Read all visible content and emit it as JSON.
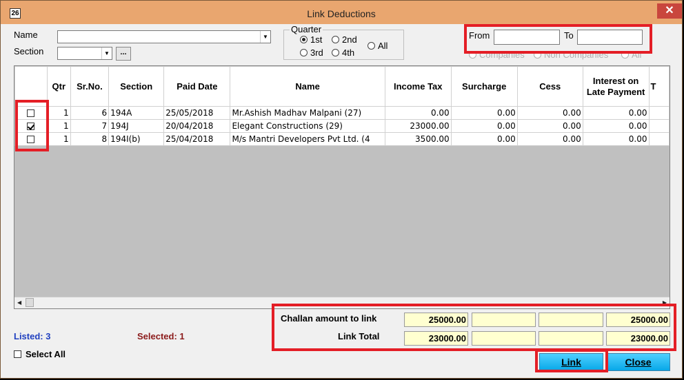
{
  "window": {
    "title": "Link Deductions",
    "icon_text": "26",
    "close_glyph": "✕"
  },
  "filters": {
    "name_label": "Name",
    "name_value": "",
    "section_label": "Section",
    "section_value": "",
    "browse_label": "...",
    "quarter": {
      "legend": "Quarter",
      "options": [
        "1st",
        "2nd",
        "3rd",
        "4th",
        "All"
      ],
      "selected": "1st"
    },
    "from_label": "From",
    "from_value": "",
    "to_label": "To",
    "to_value": "",
    "company_filter": {
      "options": [
        "Companies",
        "Non Companies",
        "All"
      ],
      "selected": "Companies"
    }
  },
  "grid": {
    "columns": [
      "",
      "Qtr",
      "Sr.No.",
      "Section",
      "Paid Date",
      "Name",
      "Income Tax",
      "Surcharge",
      "Cess",
      "Interest on Late Payment",
      "T"
    ],
    "rows": [
      {
        "checked": false,
        "qtr": "1",
        "sr": "6",
        "section": "194A",
        "paid_date": "25/05/2018",
        "name": "Mr.Ashish Madhav Malpani (27)",
        "income_tax": "0.00",
        "surcharge": "0.00",
        "cess": "0.00",
        "interest": "0.00"
      },
      {
        "checked": true,
        "qtr": "1",
        "sr": "7",
        "section": "194J",
        "paid_date": "20/04/2018",
        "name": "Elegant Constructions (29)",
        "income_tax": "23000.00",
        "surcharge": "0.00",
        "cess": "0.00",
        "interest": "0.00"
      },
      {
        "checked": false,
        "qtr": "1",
        "sr": "8",
        "section": "194I(b)",
        "paid_date": "25/04/2018",
        "name": "M/s Mantri Developers Pvt Ltd. (4",
        "income_tax": "3500.00",
        "surcharge": "0.00",
        "cess": "0.00",
        "interest": "0.00"
      }
    ]
  },
  "summary": {
    "listed": "Listed: 3",
    "selected": "Selected: 1",
    "select_all_label": "Select All",
    "challan_label": "Challan amount to link",
    "challan_values": [
      "25000.00",
      "",
      "",
      "25000.00"
    ],
    "link_total_label": "Link Total",
    "link_total_values": [
      "23000.00",
      "",
      "",
      "23000.00"
    ]
  },
  "buttons": {
    "link": "Link",
    "close": "Close"
  },
  "colors": {
    "titlebar": "#e9a66f",
    "highlight": "#e41e26",
    "listed": "#1f3fbf",
    "selected": "#8b1a1a",
    "button": "#07a8e8"
  }
}
